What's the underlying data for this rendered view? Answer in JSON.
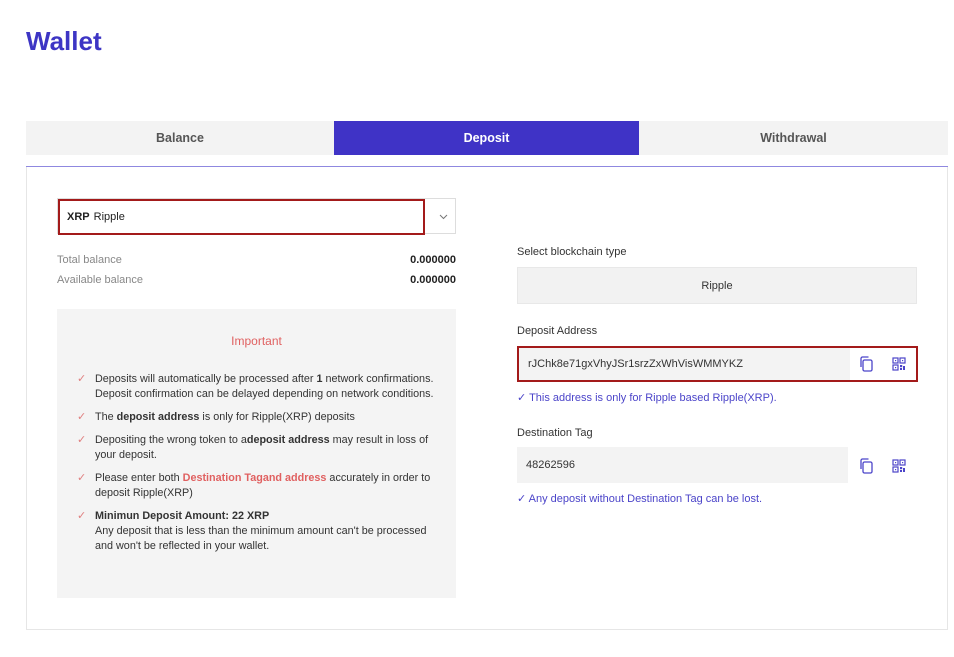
{
  "page": {
    "title": "Wallet"
  },
  "tabs": [
    {
      "label": "Balance",
      "active": false
    },
    {
      "label": "Deposit",
      "active": true
    },
    {
      "label": "Withdrawal",
      "active": false
    }
  ],
  "coin_select": {
    "symbol": "XRP",
    "name": "Ripple"
  },
  "balances": {
    "total_label": "Total balance",
    "total_value": "0.000000",
    "available_label": "Available balance",
    "available_value": "0.000000"
  },
  "important": {
    "title": "Important",
    "items": [
      {
        "parts": [
          "Deposits will automatically be processed after ",
          "1",
          " network confirmations. Deposit confirmation can be delayed depending on network conditions."
        ]
      },
      {
        "parts": [
          "The ",
          "deposit address",
          " is only for Ripple(XRP) deposits"
        ]
      },
      {
        "parts": [
          "Depositing the wrong token to a",
          "deposit address",
          " may result in loss of your deposit."
        ]
      },
      {
        "parts": [
          "Please enter both ",
          "Destination Tagand address",
          " accurately in order to deposit Ripple(XRP)"
        ]
      },
      {
        "parts": [
          "Minimun Deposit Amount: 22 XRP",
          "Any deposit that is less than the minimum amount can't be processed and won't be reflected in your wallet."
        ]
      }
    ]
  },
  "blockchain": {
    "label": "Select blockchain type",
    "value": "Ripple"
  },
  "deposit_address": {
    "label": "Deposit Address",
    "value": "rJChk8e71gxVhyJSr1srzZxWhVisWMMYKZ",
    "note": "This address is only for Ripple based Ripple(XRP)."
  },
  "destination_tag": {
    "label": "Destination Tag",
    "value": "48262596",
    "note": "Any deposit without Destination Tag can be lost."
  },
  "colors": {
    "accent": "#3f33c6",
    "highlight_border": "#a31a1a",
    "warning": "#e06060",
    "note": "#4b44c9"
  },
  "icons": {
    "copy": "copy-icon",
    "qr": "qr-code-icon",
    "check": "check-icon",
    "chevron": "chevron-down-icon"
  }
}
